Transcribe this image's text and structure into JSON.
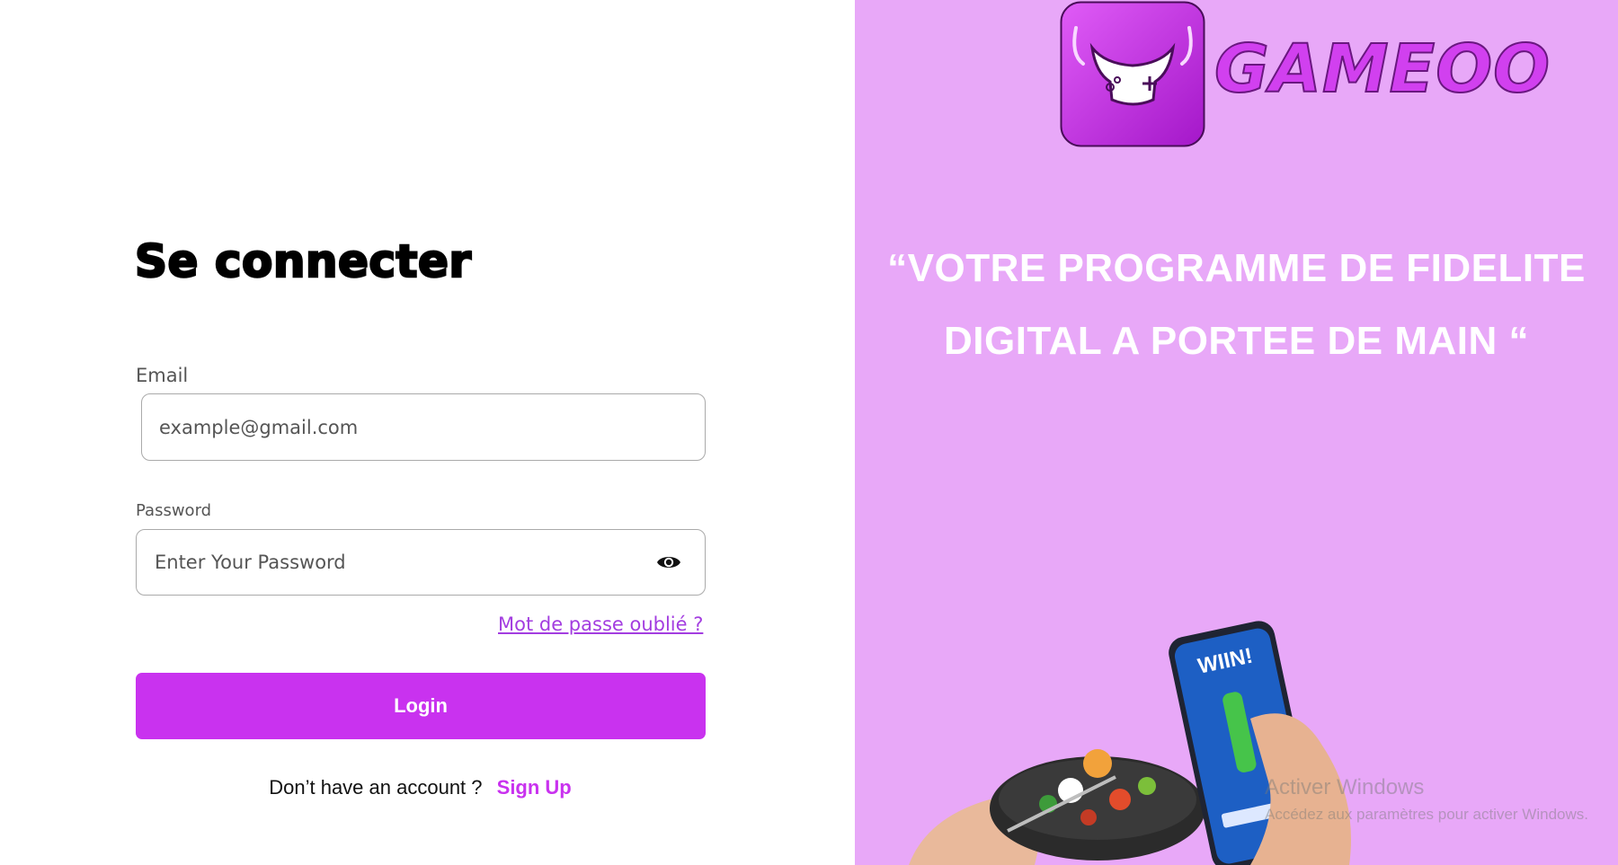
{
  "login": {
    "title": "Se connecter",
    "email_label": "Email",
    "email_placeholder": "example@gmail.com",
    "password_label": "Password",
    "password_placeholder": "Enter Your Password",
    "forgot_link": "Mot de passe oublié ?",
    "login_button": "Login",
    "signup_prompt": "Don’t have an account ?",
    "signup_link": "Sign Up"
  },
  "promo": {
    "brand": "GAMEOO",
    "quote_line1": "“VOTRE PROGRAMME DE FIDELITE",
    "quote_line2": "DIGITAL A PORTEE DE MAIN “",
    "phone_screen_title": "WIIN!"
  },
  "system": {
    "watermark_title": "Activer Windows",
    "watermark_subtitle": "Accédez aux paramètres pour activer Windows."
  },
  "colors": {
    "accent": "#c932ef",
    "right_panel_bg": "#e8a8f8",
    "link": "#a33de0"
  },
  "icons": {
    "password_toggle": "eye-icon",
    "logo": "gamepad-logo-icon"
  }
}
